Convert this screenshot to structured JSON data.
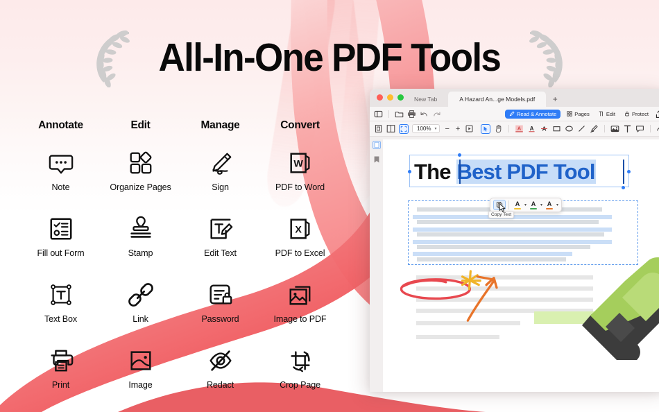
{
  "hero": {
    "title": "All-In-One PDF Tools",
    "laurel_left": "laurel-branch-left",
    "laurel_right": "laurel-branch-right",
    "ribbon_color": "#f4666a",
    "background_tint": "#fdeaea"
  },
  "features": {
    "columns": [
      {
        "heading": "Annotate"
      },
      {
        "heading": "Edit"
      },
      {
        "heading": "Manage"
      },
      {
        "heading": "Convert"
      }
    ],
    "items": [
      {
        "label": "Note",
        "icon": "note-bubble-icon"
      },
      {
        "label": "Organize Pages",
        "icon": "organize-pages-icon"
      },
      {
        "label": "Sign",
        "icon": "sign-pen-icon"
      },
      {
        "label": "PDF to Word",
        "icon": "word-file-icon"
      },
      {
        "label": "Fill out Form",
        "icon": "fill-form-icon"
      },
      {
        "label": "Stamp",
        "icon": "stamp-icon"
      },
      {
        "label": "Edit Text",
        "icon": "edit-text-icon"
      },
      {
        "label": "PDF to Excel",
        "icon": "excel-file-icon"
      },
      {
        "label": "Text Box",
        "icon": "text-box-icon"
      },
      {
        "label": "Link",
        "icon": "link-chain-icon"
      },
      {
        "label": "Password",
        "icon": "password-lock-icon"
      },
      {
        "label": "Image to PDF",
        "icon": "image-to-pdf-icon"
      },
      {
        "label": "Print",
        "icon": "printer-icon"
      },
      {
        "label": "Image",
        "icon": "image-icon"
      },
      {
        "label": "Redact",
        "icon": "redact-eye-icon"
      },
      {
        "label": "Crop Page",
        "icon": "crop-page-icon"
      }
    ]
  },
  "app": {
    "tabs": [
      {
        "label": "New Tab",
        "active": false
      },
      {
        "label": "A Hazard An...ge Models.pdf",
        "active": true
      }
    ],
    "new_tab_label": "+",
    "toolbar_primary": {
      "icons": [
        "sidebar-toggle-icon",
        "folder-icon",
        "print-icon",
        "undo-icon",
        "redo-icon"
      ],
      "modes": [
        {
          "label": "Read & Annotate",
          "icon": "pencil-icon",
          "active": true
        },
        {
          "label": "Pages",
          "icon": "pages-grid-icon",
          "active": false
        },
        {
          "label": "Edit",
          "icon": "edit-t-icon",
          "active": false
        },
        {
          "label": "Protect",
          "icon": "lock-icon",
          "active": false
        }
      ]
    },
    "toolbar_secondary": {
      "view_icons": [
        "single-page-icon",
        "two-page-icon",
        "fit-page-icon"
      ],
      "zoom_value": "100%",
      "zoom_out_label": "−",
      "zoom_in_label": "+",
      "presentation_icon": "presentation-icon",
      "annotation_icons": [
        "select-arrow-icon",
        "hand-icon",
        "highlight-text-icon",
        "underline-text-icon",
        "strikethrough-text-icon",
        "rectangle-icon",
        "ellipse-icon",
        "line-icon",
        "pencil-draw-icon",
        "image-stamp-icon",
        "text-icon",
        "note-icon",
        "signature-icon"
      ]
    },
    "side_rail": [
      "thumbnails-icon",
      "bookmark-icon"
    ],
    "document": {
      "heading_plain": "The ",
      "heading_selected": "Best PDF Tool",
      "heading_plain_color": "#111111",
      "heading_selected_color": "#1f62c9",
      "selection_highlight_color": "#c7ddf8"
    },
    "popup": {
      "copy_label": "Copy Text",
      "copy_icon": "copy-icon",
      "color_options": [
        {
          "name": "yellow-highlight",
          "color": "#f2c230"
        },
        {
          "name": "green-highlight",
          "color": "#3fa653"
        },
        {
          "name": "orange-highlight",
          "color": "#e8772a"
        }
      ],
      "letter_glyph": "A",
      "chevron": "⌄"
    },
    "annotations": {
      "ellipse_color": "#e8484f",
      "star_color": "#f0b429",
      "arrow_color": "#e8742a",
      "highlighter_body_color": "#a5ce5c",
      "highlighter_tip_color": "#3c3c3c",
      "highlight_swatch_color": "#d9f0b0"
    }
  }
}
